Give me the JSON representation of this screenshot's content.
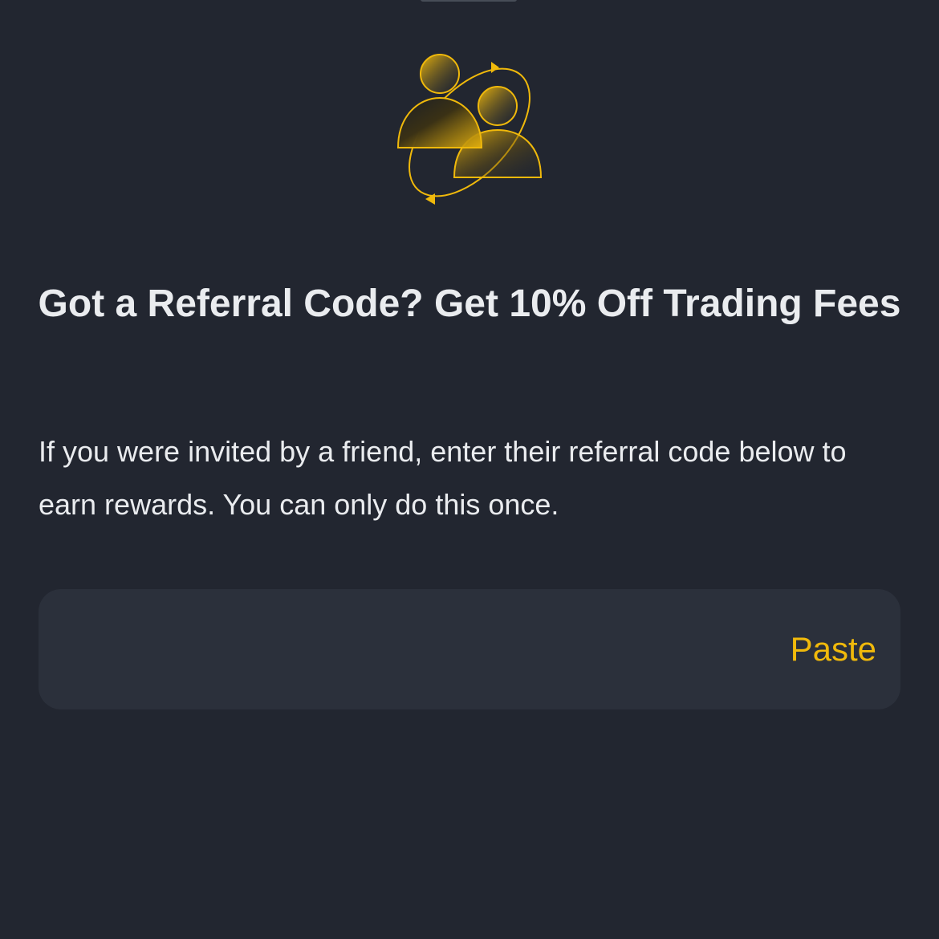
{
  "header": {
    "illustration_icon": "referral-people-orbit-icon",
    "title": "Got a Referral Code? Get 10% Off Trading Fees",
    "description": "If you were invited by a friend, enter their referral code below to earn rewards. You can only do this once."
  },
  "referral_input": {
    "value": "",
    "placeholder": "",
    "paste_label": "Paste"
  },
  "colors": {
    "background": "#222630",
    "field_background": "#2b303b",
    "accent": "#f0b90b",
    "text": "#eaecef"
  }
}
